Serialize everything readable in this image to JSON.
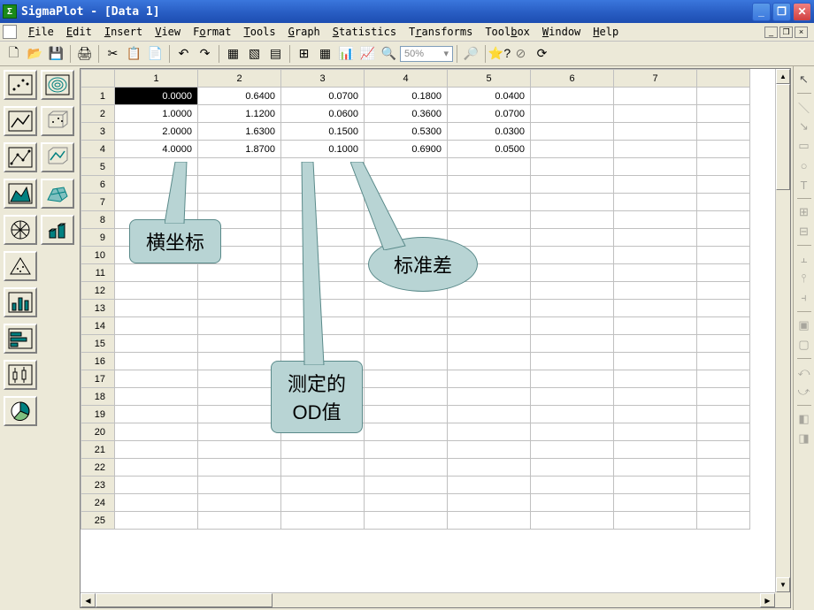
{
  "app": {
    "title": "SigmaPlot - [Data 1]"
  },
  "menu": {
    "items": [
      {
        "label": "File",
        "accel": "F"
      },
      {
        "label": "Edit",
        "accel": "E"
      },
      {
        "label": "Insert",
        "accel": "I"
      },
      {
        "label": "View",
        "accel": "V"
      },
      {
        "label": "Format",
        "accel": "F"
      },
      {
        "label": "Tools",
        "accel": "T"
      },
      {
        "label": "Graph",
        "accel": "G"
      },
      {
        "label": "Statistics",
        "accel": "S"
      },
      {
        "label": "Transforms",
        "accel": "T"
      },
      {
        "label": "Toolbox",
        "accel": "T"
      },
      {
        "label": "Window",
        "accel": "W"
      },
      {
        "label": "Help",
        "accel": "H"
      }
    ]
  },
  "toolbar": {
    "zoom": "50%"
  },
  "worksheet": {
    "columns": [
      "1",
      "2",
      "3",
      "4",
      "5",
      "6",
      "7"
    ],
    "rows": 25,
    "data": [
      [
        "0.0000",
        "0.6400",
        "0.0700",
        "0.1800",
        "0.0400"
      ],
      [
        "1.0000",
        "1.1200",
        "0.0600",
        "0.3600",
        "0.0700"
      ],
      [
        "2.0000",
        "1.6300",
        "0.1500",
        "0.5300",
        "0.0300"
      ],
      [
        "4.0000",
        "1.8700",
        "0.1000",
        "0.6900",
        "0.0500"
      ]
    ],
    "selected": {
      "row": 0,
      "col": 0
    }
  },
  "callouts": {
    "c1": "横坐标",
    "c2_line1": "测定的",
    "c2_line2": "OD值",
    "c3": "标准差"
  }
}
